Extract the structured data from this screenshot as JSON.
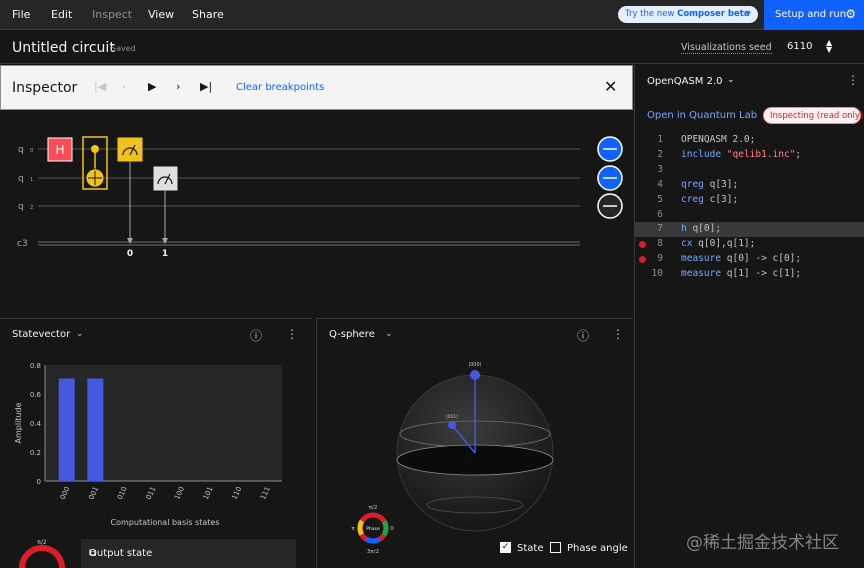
{
  "menu": {
    "file": "File",
    "edit": "Edit",
    "inspect": "Inspect",
    "view": "View",
    "share": "Share"
  },
  "promo": {
    "prefix": "Try the new ",
    "product": "Composer beta",
    "arrow": "→"
  },
  "run_button": {
    "label": "Setup and run",
    "icon": "gear-icon"
  },
  "title": {
    "circuit_name": "Untitled circuit",
    "saved": "Saved"
  },
  "seed": {
    "label": "Visualizations seed",
    "value": "6110"
  },
  "inspector": {
    "title": "Inspector",
    "controls": [
      "|◀",
      "‹",
      "▶",
      "›",
      "▶|"
    ],
    "clear_breakpoints": "Clear breakpoints",
    "close": "✕"
  },
  "circuit": {
    "qubits": [
      {
        "label": "q",
        "index": "0"
      },
      {
        "label": "q",
        "index": "1"
      },
      {
        "label": "q",
        "index": "2"
      }
    ],
    "classical": {
      "label": "c3"
    },
    "gates": {
      "h": "H",
      "measure_a_target": "0",
      "measure_b_target": "1"
    },
    "colors": {
      "h_gate": "#fa4d56",
      "cx_gate": "#f1c21b",
      "measure": "#e0e0e0",
      "bloch_active": "#0f62fe"
    }
  },
  "statevector": {
    "title": "Statevector",
    "ylabel": "Amplitude",
    "xlabel": "Computational basis states",
    "phase_label": "π/2"
  },
  "output_state": {
    "label": "Output state"
  },
  "qsphere": {
    "title": "Q-sphere",
    "state_labels": [
      "|000⟩",
      "|011⟩"
    ],
    "phase_wheel": {
      "top": "π/2",
      "left": "π",
      "right": "0",
      "bottom": "3π/2",
      "center": "Phase"
    },
    "state_checkbox": "State",
    "phase_checkbox": "Phase angle"
  },
  "chart_data": {
    "type": "bar",
    "categories": [
      "000",
      "001",
      "010",
      "011",
      "100",
      "101",
      "110",
      "111"
    ],
    "values": [
      0.707,
      0.707,
      0,
      0,
      0,
      0,
      0,
      0
    ],
    "xlabel": "Computational basis states",
    "ylabel": "Amplitude",
    "ylim": [
      0,
      0.8
    ],
    "yticks": [
      "0.8",
      "0.6",
      "0.4",
      "0.2",
      "0"
    ],
    "colors": {
      "bar": "#4259e0"
    }
  },
  "code_panel": {
    "title": "OpenQASM 2.0",
    "open_lab": "Open in Quantum Lab",
    "inspecting": "Inspecting (read only)",
    "lines": [
      {
        "no": "1",
        "text": "OPENQASM 2.0;"
      },
      {
        "no": "2",
        "text": "include \"qelib1.inc\";"
      },
      {
        "no": "3",
        "text": ""
      },
      {
        "no": "4",
        "text": "qreg q[3];"
      },
      {
        "no": "5",
        "text": "creg c[3];"
      },
      {
        "no": "6",
        "text": ""
      },
      {
        "no": "7",
        "text": "h q[0];"
      },
      {
        "no": "8",
        "text": "cx q[0],q[1];"
      },
      {
        "no": "9",
        "text": "measure q[0] -> c[0];"
      },
      {
        "no": "10",
        "text": "measure q[1] -> c[1];"
      }
    ]
  },
  "watermark": "@稀土掘金技术社区"
}
